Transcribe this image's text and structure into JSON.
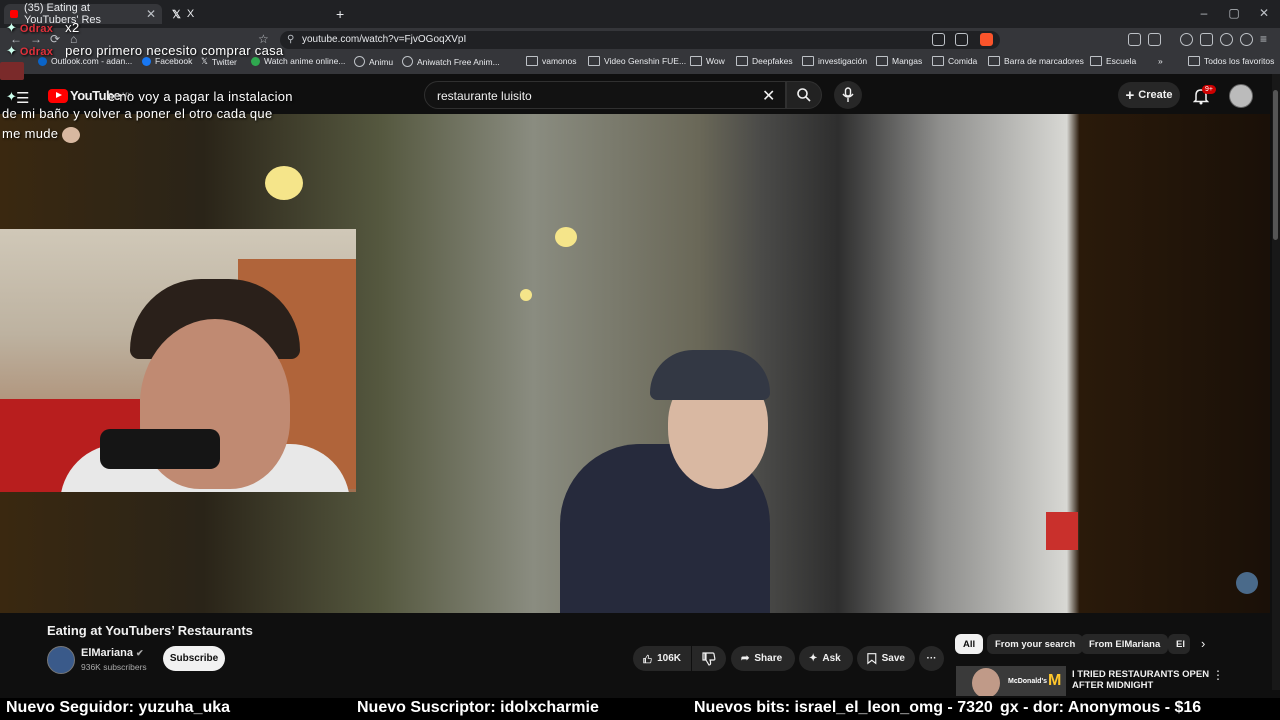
{
  "browser": {
    "tabs": [
      {
        "label": "(35) Eating at YouTubers' Res",
        "active": true
      },
      {
        "label": "X",
        "active": false
      }
    ],
    "new_tab": "+",
    "window_buttons": [
      "–",
      "▢",
      "✕"
    ],
    "url": "youtube.com/watch?v=FjvOGoqXVpI",
    "bookmarks": [
      {
        "label": "Outlook.com - adan...",
        "icon": "outlook-icon"
      },
      {
        "label": "Facebook",
        "icon": "facebook-icon"
      },
      {
        "label": "Twitter",
        "icon": "x-icon"
      },
      {
        "label": "Watch anime online...",
        "icon": "anime-icon"
      },
      {
        "label": "Animu",
        "icon": "site-icon"
      },
      {
        "label": "Aniwatch Free Anim...",
        "icon": "site-icon"
      },
      {
        "label": "vamonos",
        "icon": "folder-icon"
      },
      {
        "label": "Video Genshin FUE...",
        "icon": "folder-icon"
      },
      {
        "label": "Wow",
        "icon": "folder-icon"
      },
      {
        "label": "Deepfakes",
        "icon": "folder-icon"
      },
      {
        "label": "investigación",
        "icon": "folder-icon"
      },
      {
        "label": "Mangas",
        "icon": "folder-icon"
      },
      {
        "label": "Comida",
        "icon": "folder-icon"
      },
      {
        "label": "Barra de marcadores",
        "icon": "folder-icon"
      },
      {
        "label": "Escuela",
        "icon": "folder-icon"
      }
    ],
    "more_bookmarks": "»",
    "all_bookmarks": "Todos los favoritos"
  },
  "youtube": {
    "logo_text": "YouTube",
    "logo_region": "MX",
    "search": {
      "value": "restaurante luisito",
      "placeholder": "Search"
    },
    "create_label": "Create",
    "notifications_count": "9+",
    "video": {
      "title": "Eating at YouTubers’ Restaurants",
      "channel": "ElMariana",
      "subscribers": "936K subscribers",
      "subscribe_label": "Subscribe",
      "likes": "106K",
      "share_label": "Share",
      "ask_label": "Ask",
      "save_label": "Save",
      "more_label": "···"
    },
    "chips": [
      {
        "label": "All",
        "active": true
      },
      {
        "label": "From your search",
        "active": false
      },
      {
        "label": "From ElMariana",
        "active": false
      },
      {
        "label": "El",
        "active": false
      }
    ],
    "recommendation": {
      "title": "I TRIED RESTAURANTS OPEN AFTER MIDNIGHT",
      "thumb_brand": "McDonald's"
    }
  },
  "overlay": {
    "chat": [
      {
        "user": "Odrax",
        "text": "x2"
      },
      {
        "user": "Odrax",
        "text": "pero primero necesito comprar casa"
      },
      {
        "user": "",
        "text": "e no voy a pagar la instalacion"
      },
      {
        "user": "",
        "text": "de mi baño y volver a poner el otro cada que"
      },
      {
        "user": "",
        "text": "me mude"
      }
    ],
    "ticker": [
      "Nuevo Seguidor: yuzuha_uka",
      "Nuevo Suscriptor: idolxcharmie",
      "Nuevos bits: israel_el_leon_omg - 7320",
      "gx - dor: Anonymous - $16"
    ]
  },
  "colors": {
    "yt_red": "#ff0000",
    "bg": "#0f0f0f",
    "pill": "#272727",
    "chat_user": "#e0303a"
  }
}
